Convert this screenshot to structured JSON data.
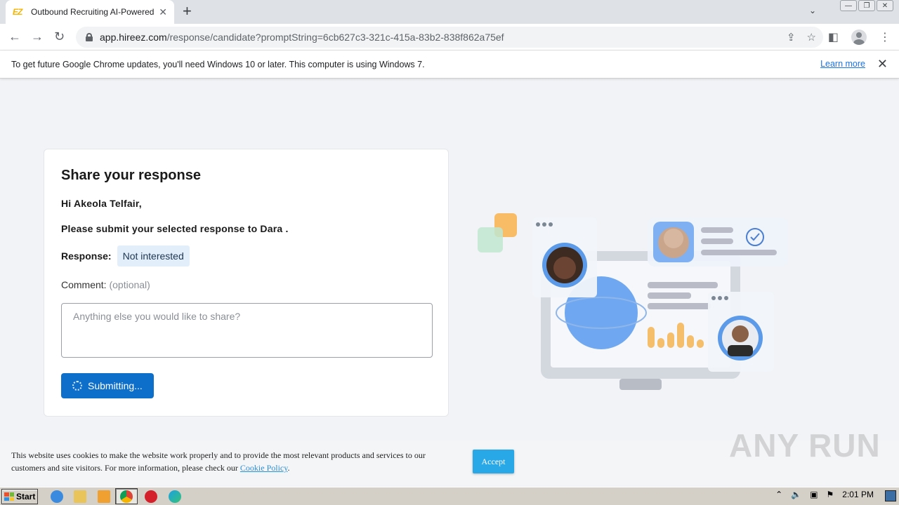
{
  "browser": {
    "tab_title": "Outbound Recruiting AI-Powered Platform | hireEZ",
    "tab_favicon_text": "EZ",
    "url_host": "app.hireez.com",
    "url_path": "/response/candidate?promptString=6cb627c3-321c-415a-83b2-838f862a75ef"
  },
  "infobar": {
    "message": "To get future Google Chrome updates, you'll need Windows 10 or later. This computer is using Windows 7.",
    "link": "Learn more"
  },
  "card": {
    "title": "Share your response",
    "greeting": "Hi Akeola Telfair,",
    "instruction": "Please submit your selected response to Dara .",
    "response_label": "Response:",
    "response_value": "Not interested",
    "comment_label": "Comment:",
    "comment_optional": "(optional)",
    "comment_placeholder": "Anything else you would like to share?",
    "submit_label": "Submitting..."
  },
  "cookie": {
    "text": "This website uses cookies to make the website work properly and to provide the most relevant products and services to our customers and site visitors. For more information, please check our",
    "link": "Cookie Policy",
    "end": ".",
    "accept_label": "Accept"
  },
  "watermark": "ANY RUN",
  "taskbar": {
    "start_label": "Start",
    "clock": "2:01 PM"
  },
  "colors": {
    "primary_button": "#0d6fc9",
    "response_chip_bg": "#e2effb",
    "accept_button": "#29a8e8",
    "page_bg": "#f1f3f6"
  }
}
